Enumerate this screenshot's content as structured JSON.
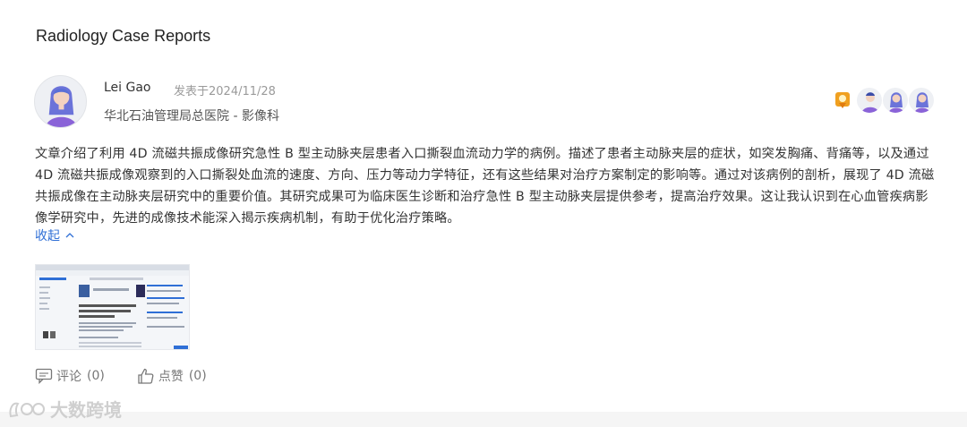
{
  "page": {
    "title": "Radiology Case Reports"
  },
  "post": {
    "author": "Lei Gao",
    "posted": "发表于2024/11/28",
    "affiliation": "华北石油管理局总医院 - 影像科",
    "body": "文章介绍了利用 4D 流磁共振成像研究急性 B 型主动脉夹层患者入口撕裂血流动力学的病例。描述了患者主动脉夹层的症状，如突发胸痛、背痛等，以及通过 4D 流磁共振成像观察到的入口撕裂处血流的速度、方向、压力等动力学特征，还有这些结果对治疗方案制定的影响等。通过对该病例的剖析，展现了 4D 流磁共振成像在主动脉夹层研究中的重要价值。其研究成果可为临床医生诊断和治疗急性 B 型主动脉夹层提供参考，提高治疗效果。这让我认识到在心血管疾病影像学研究中，先进的成像技术能深入揭示疾病机制，有助于优化治疗策略。",
    "collapse_label": "收起",
    "comment_label": "评论",
    "comment_count": "(0)",
    "like_label": "点赞",
    "like_count": "(0)"
  },
  "icons": {
    "medal": "medal-icon",
    "chevron": "chevron-up-icon",
    "comment": "comment-icon",
    "like": "thumbs-up-icon"
  },
  "watermark": {
    "text": "大数跨境"
  },
  "colors": {
    "accent": "#2f6fd6",
    "medal": "#f0a020",
    "avatar_hair": "#5b6fd6",
    "avatar_body": "#8a63d8"
  }
}
